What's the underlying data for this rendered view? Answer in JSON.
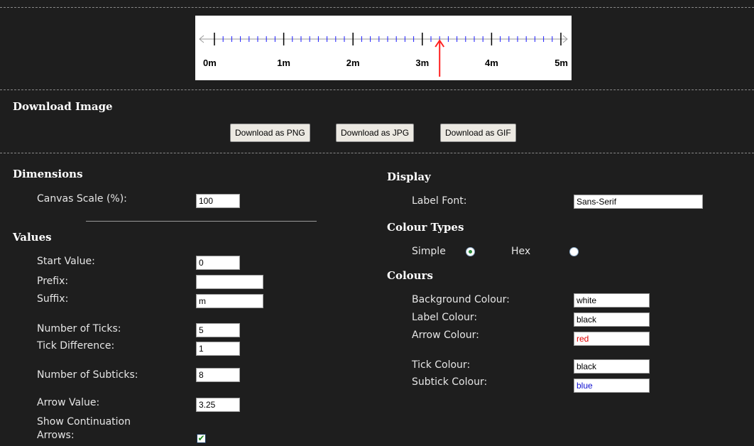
{
  "preview": {
    "tick_labels": [
      "0m",
      "1m",
      "2m",
      "3m",
      "4m",
      "5m"
    ],
    "arrow_value": 3.25,
    "ticks": 5,
    "subticks": 8,
    "colors": {
      "background": "#ffffff",
      "tick": "#000000",
      "subtick": "#1a1aff",
      "arrow": "#ff2020",
      "line": "#9a9a9a"
    }
  },
  "download": {
    "heading": "Download Image",
    "png_label": "Download as PNG",
    "jpg_label": "Download as JPG",
    "gif_label": "Download as GIF"
  },
  "dimensions": {
    "heading": "Dimensions",
    "canvas_scale_label": "Canvas Scale (%):",
    "canvas_scale_value": "100"
  },
  "values": {
    "heading": "Values",
    "start_value_label": "Start Value:",
    "start_value": "0",
    "prefix_label": "Prefix:",
    "prefix_value": "",
    "suffix_label": "Suffix:",
    "suffix_value": "m",
    "num_ticks_label": "Number of Ticks:",
    "num_ticks_value": "5",
    "tick_diff_label": "Tick Difference:",
    "tick_diff_value": "1",
    "num_subticks_label": "Number of Subticks:",
    "num_subticks_value": "8",
    "arrow_value_label": "Arrow Value:",
    "arrow_value": "3.25",
    "show_arrows_label_1": "Show Continuation",
    "show_arrows_label_2": "Arrows:",
    "show_arrows_checked": true
  },
  "display": {
    "heading": "Display",
    "label_font_label": "Label Font:",
    "label_font_value": "Sans-Serif"
  },
  "colour_types": {
    "heading": "Colour Types",
    "simple_label": "Simple",
    "hex_label": "Hex",
    "selected": "simple"
  },
  "colours": {
    "heading": "Colours",
    "background_label": "Background Colour:",
    "background_value": "white",
    "label_label": "Label Colour:",
    "label_value": "black",
    "arrow_label": "Arrow Colour:",
    "arrow_value": "red",
    "tick_label": "Tick Colour:",
    "tick_value": "black",
    "subtick_label": "Subtick Colour:",
    "subtick_value": "blue"
  }
}
